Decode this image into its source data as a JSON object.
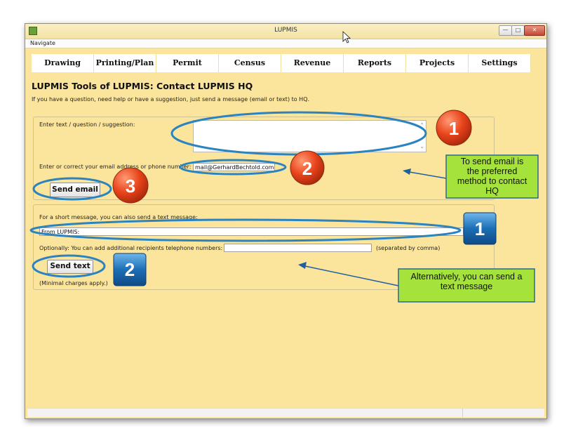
{
  "window": {
    "title": "LUPMIS",
    "minimize_label": "—",
    "maximize_label": "□",
    "close_label": "✕"
  },
  "menu": {
    "navigate": "Navigate"
  },
  "tabs": [
    "Drawing",
    "Printing/Plan",
    "Permit",
    "Census",
    "Revenue",
    "Reports",
    "Projects",
    "Settings"
  ],
  "page": {
    "title": "LUPMIS Tools of LUPMIS: Contact LUPMIS HQ",
    "subtitle": "If you have a question, need help or have a suggestion, just send a message (email or text) to HQ."
  },
  "email_section": {
    "text_label": "Enter text / question / suggestion:",
    "text_value": "",
    "contact_label": "Enter or correct your email address or phone number:",
    "contact_value": "mail@GerhardBechtold.com",
    "send_label": "Send email"
  },
  "text_section": {
    "intro": "For a short message, you can also send a text message:",
    "message_value": "From LUPMIS:",
    "recipients_label": "Optionally: You can add additional recipients telephone numbers:",
    "recipients_value": "",
    "recipients_hint": "(separated by comma)",
    "send_label": "Send text",
    "note": "(Minimal charges apply.)"
  },
  "annotations": {
    "email_badges": [
      "1",
      "2",
      "3"
    ],
    "text_badges": [
      "1",
      "2"
    ],
    "email_callout": [
      "To send email is",
      "the preferred",
      "method to contact",
      "HQ"
    ],
    "text_callout": [
      "Alternatively, you can send a",
      "text message"
    ]
  },
  "colors": {
    "window_bg": "#fbe59d",
    "annotation_ring": "#2b83c0",
    "orange_badge": "#e8431b",
    "blue_badge": "#1c6fb5",
    "callout_bg": "#a6e23c",
    "arrow": "#1f5fa0"
  },
  "icons": {
    "cursor": "mouse-pointer-icon",
    "scroll_up": "scroll-up-icon",
    "scroll_down": "scroll-down-icon"
  }
}
